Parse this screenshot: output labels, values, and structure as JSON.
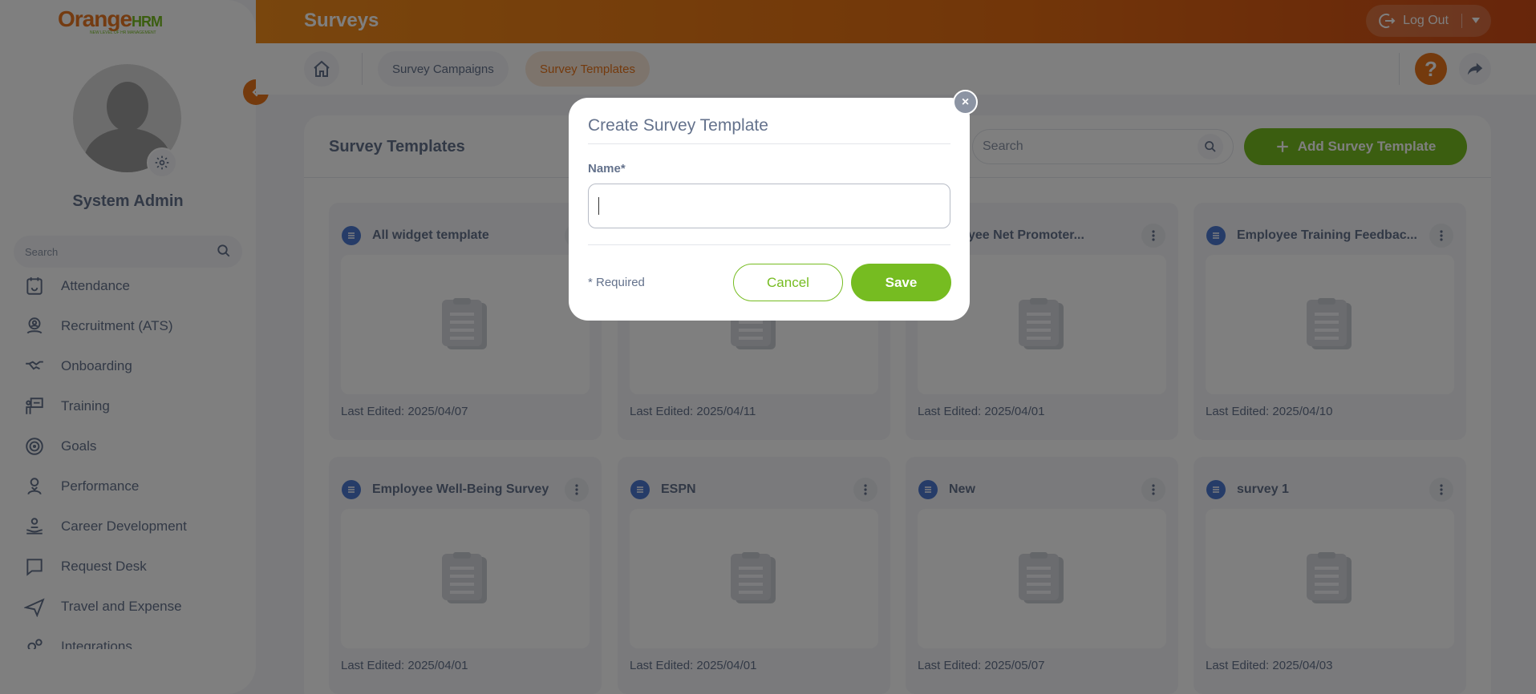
{
  "brand": {
    "logo_main": "range",
    "logo_o": "O",
    "logo_hrm": "HRM",
    "logo_tagline": "NEW LEVEL OF HR MANAGEMENT",
    "accent_color": "#e8751a",
    "primary_green": "#76bc21"
  },
  "sidebar": {
    "user_name": "System Admin",
    "search_placeholder": "Search",
    "items": [
      {
        "label": "Attendance",
        "icon": "attendance-icon"
      },
      {
        "label": "Recruitment (ATS)",
        "icon": "recruitment-icon"
      },
      {
        "label": "Onboarding",
        "icon": "handshake-icon"
      },
      {
        "label": "Training",
        "icon": "training-icon"
      },
      {
        "label": "Goals",
        "icon": "target-icon"
      },
      {
        "label": "Performance",
        "icon": "performance-icon"
      },
      {
        "label": "Career Development",
        "icon": "career-icon"
      },
      {
        "label": "Request Desk",
        "icon": "request-desk-icon"
      },
      {
        "label": "Travel and Expense",
        "icon": "plane-icon"
      },
      {
        "label": "Integrations",
        "icon": "gears-icon"
      }
    ]
  },
  "topbar": {
    "title": "Surveys",
    "logout_label": "Log Out"
  },
  "navbar": {
    "tabs": [
      {
        "label": "Survey Campaigns",
        "active": false
      },
      {
        "label": "Survey Templates",
        "active": true
      }
    ],
    "help_label": "?"
  },
  "main": {
    "title": "Survey Templates",
    "search_placeholder": "Search",
    "add_label": "Add Survey Template",
    "cards": [
      {
        "title": "All widget template",
        "date": "Last Edited: 2025/04/07"
      },
      {
        "title": "",
        "date": "Last Edited: 2025/04/11"
      },
      {
        "title": "ployee Net Promoter...",
        "date": "Last Edited: 2025/04/01"
      },
      {
        "title": "Employee Training Feedbac...",
        "date": "Last Edited: 2025/04/10"
      },
      {
        "title": "Employee Well-Being Survey",
        "date": "Last Edited: 2025/04/01"
      },
      {
        "title": "ESPN",
        "date": "Last Edited: 2025/04/01"
      },
      {
        "title": "New",
        "date": "Last Edited: 2025/05/07"
      },
      {
        "title": "survey 1",
        "date": "Last Edited: 2025/04/03"
      }
    ]
  },
  "dialog": {
    "title": "Create Survey Template",
    "name_label": "Name*",
    "name_value": "",
    "required_note": "* Required",
    "cancel_label": "Cancel",
    "save_label": "Save",
    "close_symbol": "×"
  }
}
